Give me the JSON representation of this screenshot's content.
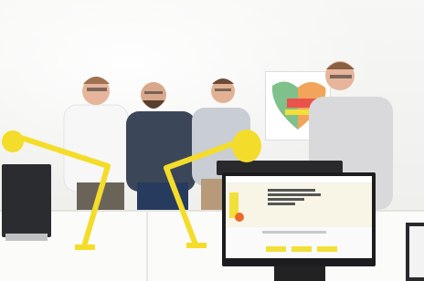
{
  "scene": {
    "description_free": true,
    "colors": {
      "wall": "#f3f3f1",
      "lamp_yellow": "#f4dd2a",
      "monitor_black": "#1d1d1f",
      "accent_orange": "#ea6a2b"
    },
    "people_count": 4
  }
}
